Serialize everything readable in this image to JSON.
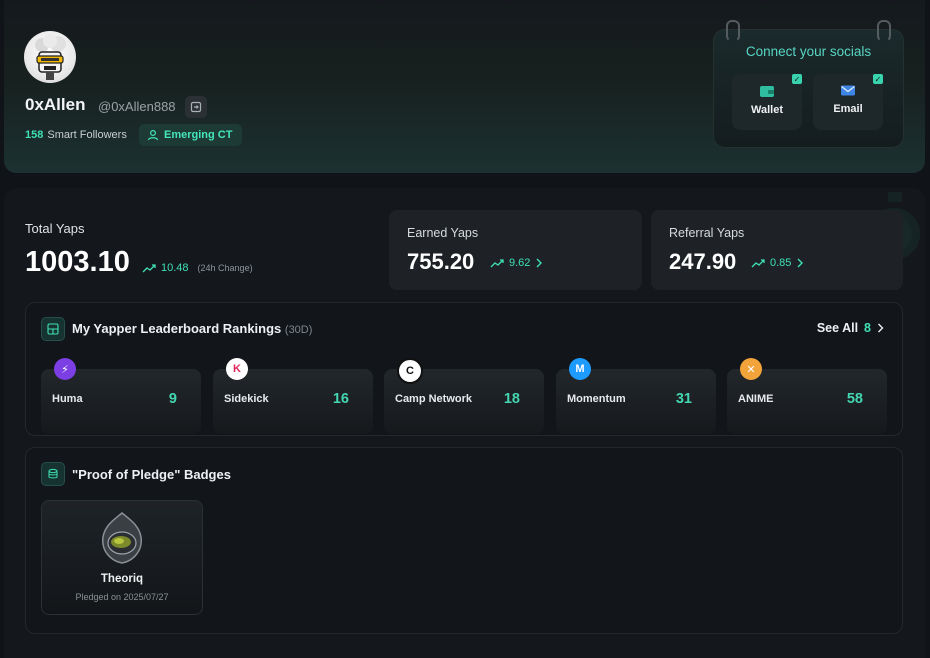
{
  "profile": {
    "username": "0xAllen",
    "handle": "@0xAllen888",
    "smart_followers_count": "158",
    "smart_followers_label": "Smart Followers",
    "badge": "Emerging CT"
  },
  "socials": {
    "title": "Connect your socials",
    "buttons": [
      {
        "label": "Wallet",
        "icon": "wallet-icon",
        "connected": true
      },
      {
        "label": "Email",
        "icon": "mail-icon",
        "connected": true
      }
    ]
  },
  "yaps": {
    "total_label": "Total Yaps",
    "total_value": "1003.10",
    "total_change": "10.48",
    "total_change_note": "(24h Change)",
    "earned_label": "Earned Yaps",
    "earned_value": "755.20",
    "earned_change": "9.62",
    "referral_label": "Referral Yaps",
    "referral_value": "247.90",
    "referral_change": "0.85"
  },
  "leaderboard": {
    "title": "My Yapper Leaderboard Rankings",
    "period": "(30D)",
    "see_all_label": "See All",
    "see_all_count": "8",
    "items": [
      {
        "name": "Huma",
        "rank": "9",
        "color": "#7b3fe4",
        "glyph": "⚡"
      },
      {
        "name": "Sidekick",
        "rank": "16",
        "color": "#ffffff",
        "glyph": "K"
      },
      {
        "name": "Camp Network",
        "rank": "18",
        "color": "#ffffff",
        "glyph": "C"
      },
      {
        "name": "Momentum",
        "rank": "31",
        "color": "#1e9bff",
        "glyph": "M"
      },
      {
        "name": "ANIME",
        "rank": "58",
        "color": "#f2a33a",
        "glyph": "✕"
      }
    ]
  },
  "pledge": {
    "title": "\"Proof of Pledge\" Badges",
    "badges": [
      {
        "name": "Theoriq",
        "date": "Pledged on 2025/07/27"
      }
    ]
  },
  "colors": {
    "accent": "#3fe0b4",
    "background": "#101317"
  }
}
